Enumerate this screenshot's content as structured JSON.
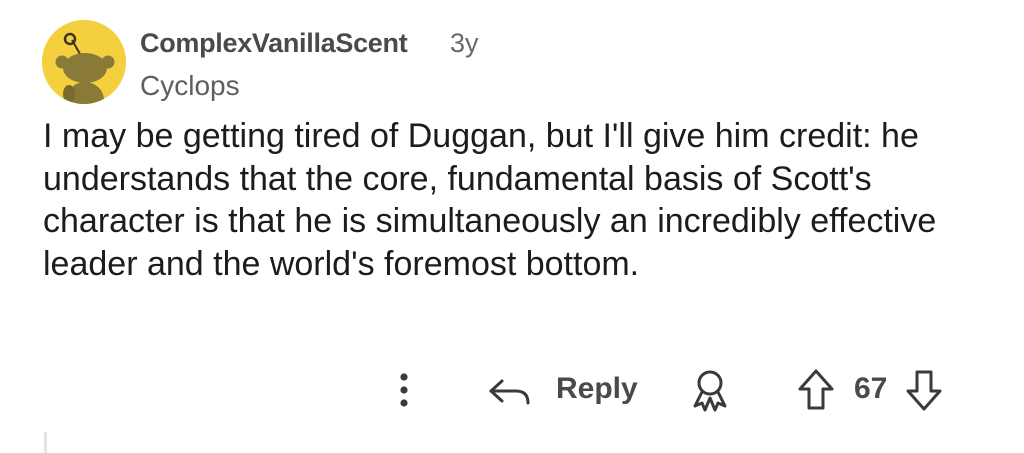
{
  "comment": {
    "username": "ComplexVanillaScent",
    "age": "3y",
    "flair": "Cyclops",
    "body": "I may be getting tired of Duggan, but I'll give him credit: he understands that the core, fundamental basis of Scott's character is that he is simultaneously an incredibly effective leader and the world's foremost bottom.",
    "avatar": {
      "icon": "snoo-avatar-icon",
      "background_color": "#f4d03f"
    }
  },
  "actions": {
    "more_icon": "more-vertical-icon",
    "reply_icon": "reply-arrow-icon",
    "reply_label": "Reply",
    "award_icon": "award-icon",
    "upvote_icon": "upvote-arrow-icon",
    "vote_count": "67",
    "downvote_icon": "downvote-arrow-icon"
  }
}
